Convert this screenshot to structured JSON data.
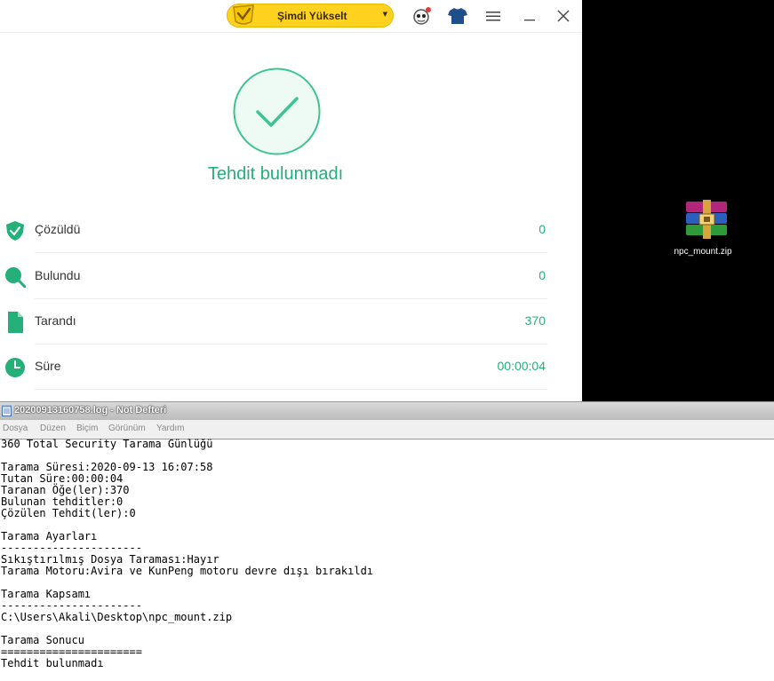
{
  "app": {
    "upgrade_label": "Şimdi Yükselt",
    "result_title": "Tehdit bulunmadı",
    "stats": [
      {
        "label": "Çözüldü",
        "value": "0"
      },
      {
        "label": "Bulundu",
        "value": "0"
      },
      {
        "label": "Tarandı",
        "value": "370"
      },
      {
        "label": "Süre",
        "value": "00:00:04"
      }
    ],
    "accent_color": "#23b079"
  },
  "desktop": {
    "file_name": "npc_mount.zip"
  },
  "notepad": {
    "title": "20200913160758.log - Not Defteri",
    "menu": [
      "Dosya",
      "Düzen",
      "Biçim",
      "Görünüm",
      "Yardım"
    ],
    "content": "360 Total Security Tarama Günlüğü\n\nTarama Süresi:2020-09-13 16:07:58\nTutan Süre:00:00:04\nTaranan Öğe(ler):370\nBulunan tehditler:0\nÇözülen Tehdit(ler):0\n\nTarama Ayarları\n----------------------\nSıkıştırılmış Dosya Taraması:Hayır\nTarama Motoru:Avira ve KunPeng motoru devre dışı bırakıldı\n\nTarama Kapsamı\n----------------------\nC:\\Users\\Akali\\Desktop\\npc_mount.zip\n\nTarama Sonucu\n======================\nTehdit bulunmadı"
  }
}
